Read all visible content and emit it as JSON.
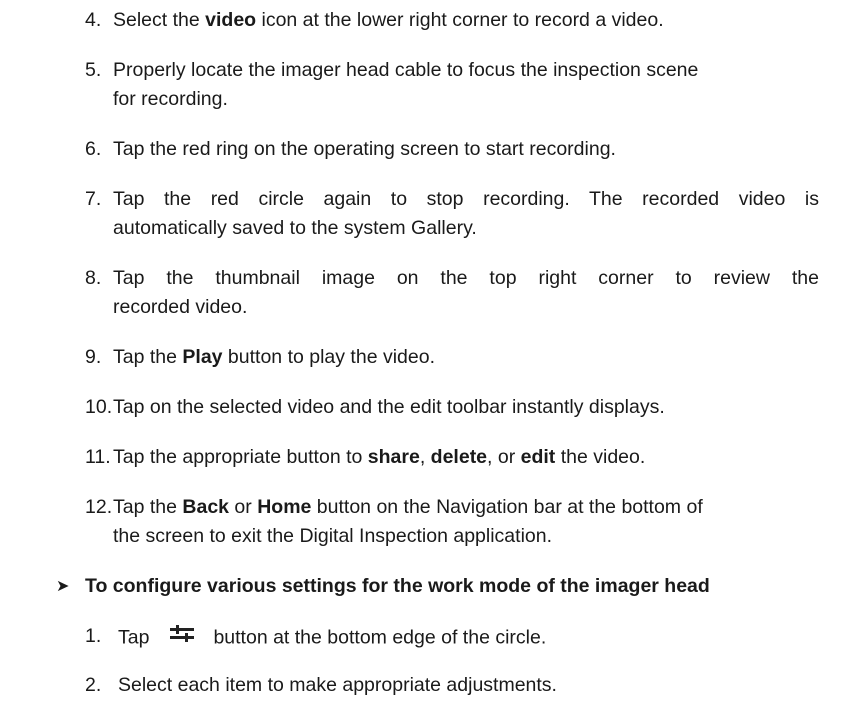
{
  "steps": {
    "s4": {
      "num": "4.",
      "pre": "Select the ",
      "bold": "video",
      "post": " icon at the lower right corner to record a video."
    },
    "s5": {
      "num": "5.",
      "line1": "Properly locate the imager head cable to focus the inspection scene",
      "line2": "for recording."
    },
    "s6": {
      "num": "6.",
      "text": "Tap the red ring on the operating screen to start recording."
    },
    "s7": {
      "num": "7.",
      "line1": "Tap the red circle again to stop recording. The recorded video is",
      "line2": "automatically saved to the system Gallery."
    },
    "s8": {
      "num": "8.",
      "line1": "Tap the thumbnail image on the top right corner to review the",
      "line2": "recorded video."
    },
    "s9": {
      "num": "9.",
      "pre": "Tap the ",
      "bold": "Play",
      "post": " button to play the video."
    },
    "s10": {
      "num": "10.",
      "text": "Tap on the selected video and the edit toolbar instantly displays."
    },
    "s11": {
      "num": "11.",
      "pre": "Tap the appropriate button to ",
      "b1": "share",
      "sep1": ", ",
      "b2": "delete",
      "sep2": ", or ",
      "b3": "edit",
      "post": " the video."
    },
    "s12": {
      "num": "12.",
      "pre": "Tap the ",
      "b1": "Back",
      "mid": " or ",
      "b2": "Home",
      "post": " button on the Navigation bar at the bottom of",
      "line2": "the screen to exit the Digital Inspection application."
    }
  },
  "section": {
    "bullet_icon": "arrow-bullet-icon",
    "heading": "To configure various settings for the work mode of the imager head",
    "items": [
      {
        "num": "1.",
        "pre": "Tap",
        "icon": "settings-sliders-icon",
        "post": "button at the bottom edge of the circle."
      },
      {
        "num": "2.",
        "text": "Select each item to make appropriate adjustments."
      }
    ]
  }
}
